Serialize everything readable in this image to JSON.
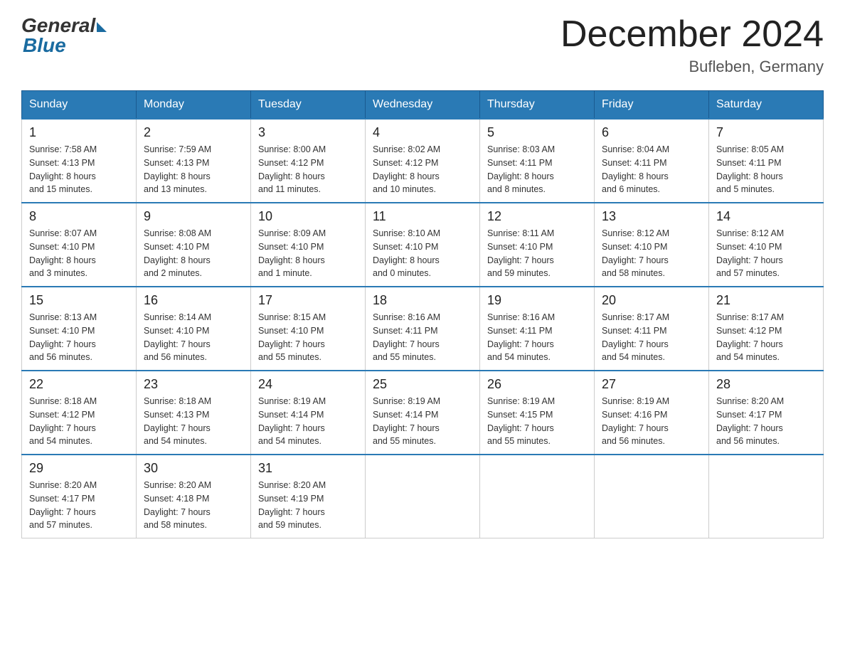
{
  "header": {
    "logo_general": "General",
    "logo_blue": "Blue",
    "title": "December 2024",
    "location": "Bufleben, Germany"
  },
  "weekdays": [
    "Sunday",
    "Monday",
    "Tuesday",
    "Wednesday",
    "Thursday",
    "Friday",
    "Saturday"
  ],
  "weeks": [
    [
      {
        "day": "1",
        "sunrise": "7:58 AM",
        "sunset": "4:13 PM",
        "daylight": "8 hours and 15 minutes."
      },
      {
        "day": "2",
        "sunrise": "7:59 AM",
        "sunset": "4:13 PM",
        "daylight": "8 hours and 13 minutes."
      },
      {
        "day": "3",
        "sunrise": "8:00 AM",
        "sunset": "4:12 PM",
        "daylight": "8 hours and 11 minutes."
      },
      {
        "day": "4",
        "sunrise": "8:02 AM",
        "sunset": "4:12 PM",
        "daylight": "8 hours and 10 minutes."
      },
      {
        "day": "5",
        "sunrise": "8:03 AM",
        "sunset": "4:11 PM",
        "daylight": "8 hours and 8 minutes."
      },
      {
        "day": "6",
        "sunrise": "8:04 AM",
        "sunset": "4:11 PM",
        "daylight": "8 hours and 6 minutes."
      },
      {
        "day": "7",
        "sunrise": "8:05 AM",
        "sunset": "4:11 PM",
        "daylight": "8 hours and 5 minutes."
      }
    ],
    [
      {
        "day": "8",
        "sunrise": "8:07 AM",
        "sunset": "4:10 PM",
        "daylight": "8 hours and 3 minutes."
      },
      {
        "day": "9",
        "sunrise": "8:08 AM",
        "sunset": "4:10 PM",
        "daylight": "8 hours and 2 minutes."
      },
      {
        "day": "10",
        "sunrise": "8:09 AM",
        "sunset": "4:10 PM",
        "daylight": "8 hours and 1 minute."
      },
      {
        "day": "11",
        "sunrise": "8:10 AM",
        "sunset": "4:10 PM",
        "daylight": "8 hours and 0 minutes."
      },
      {
        "day": "12",
        "sunrise": "8:11 AM",
        "sunset": "4:10 PM",
        "daylight": "7 hours and 59 minutes."
      },
      {
        "day": "13",
        "sunrise": "8:12 AM",
        "sunset": "4:10 PM",
        "daylight": "7 hours and 58 minutes."
      },
      {
        "day": "14",
        "sunrise": "8:12 AM",
        "sunset": "4:10 PM",
        "daylight": "7 hours and 57 minutes."
      }
    ],
    [
      {
        "day": "15",
        "sunrise": "8:13 AM",
        "sunset": "4:10 PM",
        "daylight": "7 hours and 56 minutes."
      },
      {
        "day": "16",
        "sunrise": "8:14 AM",
        "sunset": "4:10 PM",
        "daylight": "7 hours and 56 minutes."
      },
      {
        "day": "17",
        "sunrise": "8:15 AM",
        "sunset": "4:10 PM",
        "daylight": "7 hours and 55 minutes."
      },
      {
        "day": "18",
        "sunrise": "8:16 AM",
        "sunset": "4:11 PM",
        "daylight": "7 hours and 55 minutes."
      },
      {
        "day": "19",
        "sunrise": "8:16 AM",
        "sunset": "4:11 PM",
        "daylight": "7 hours and 54 minutes."
      },
      {
        "day": "20",
        "sunrise": "8:17 AM",
        "sunset": "4:11 PM",
        "daylight": "7 hours and 54 minutes."
      },
      {
        "day": "21",
        "sunrise": "8:17 AM",
        "sunset": "4:12 PM",
        "daylight": "7 hours and 54 minutes."
      }
    ],
    [
      {
        "day": "22",
        "sunrise": "8:18 AM",
        "sunset": "4:12 PM",
        "daylight": "7 hours and 54 minutes."
      },
      {
        "day": "23",
        "sunrise": "8:18 AM",
        "sunset": "4:13 PM",
        "daylight": "7 hours and 54 minutes."
      },
      {
        "day": "24",
        "sunrise": "8:19 AM",
        "sunset": "4:14 PM",
        "daylight": "7 hours and 54 minutes."
      },
      {
        "day": "25",
        "sunrise": "8:19 AM",
        "sunset": "4:14 PM",
        "daylight": "7 hours and 55 minutes."
      },
      {
        "day": "26",
        "sunrise": "8:19 AM",
        "sunset": "4:15 PM",
        "daylight": "7 hours and 55 minutes."
      },
      {
        "day": "27",
        "sunrise": "8:19 AM",
        "sunset": "4:16 PM",
        "daylight": "7 hours and 56 minutes."
      },
      {
        "day": "28",
        "sunrise": "8:20 AM",
        "sunset": "4:17 PM",
        "daylight": "7 hours and 56 minutes."
      }
    ],
    [
      {
        "day": "29",
        "sunrise": "8:20 AM",
        "sunset": "4:17 PM",
        "daylight": "7 hours and 57 minutes."
      },
      {
        "day": "30",
        "sunrise": "8:20 AM",
        "sunset": "4:18 PM",
        "daylight": "7 hours and 58 minutes."
      },
      {
        "day": "31",
        "sunrise": "8:20 AM",
        "sunset": "4:19 PM",
        "daylight": "7 hours and 59 minutes."
      },
      null,
      null,
      null,
      null
    ]
  ],
  "labels": {
    "sunrise": "Sunrise:",
    "sunset": "Sunset:",
    "daylight": "Daylight:"
  }
}
